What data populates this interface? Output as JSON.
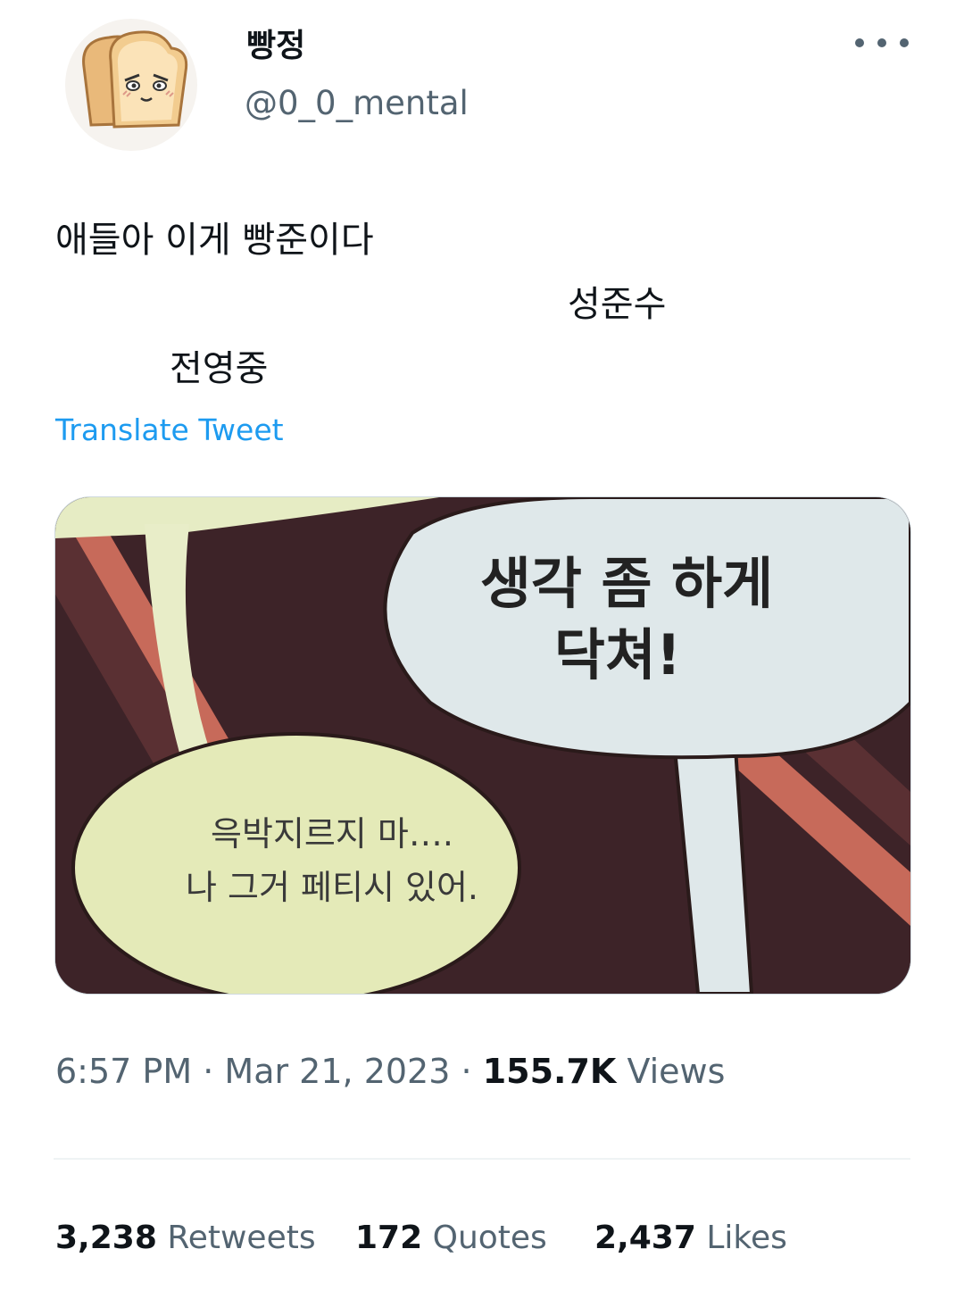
{
  "header": {
    "display_name": "빵정",
    "handle": "@0_0_mental",
    "avatar_icon": "bread-face-icon",
    "more_icon": "more-options-icon"
  },
  "tweet": {
    "lines": [
      "애들아 이게 빵준이다",
      "성준수",
      "전영중"
    ],
    "translate_label": "Translate Tweet"
  },
  "media": {
    "bubble_top": [
      "생각 좀 하게",
      "닥쳐!"
    ],
    "bubble_bottom": [
      "윽박지르지 마….",
      "나 그거 페티시 있어."
    ]
  },
  "meta": {
    "time": "6:57 PM",
    "separator": "·",
    "date": "Mar 21, 2023",
    "views_count": "155.7K",
    "views_label": "Views"
  },
  "stats": {
    "retweets_count": "3,238",
    "retweets_label": "Retweets",
    "quotes_count": "172",
    "quotes_label": "Quotes",
    "likes_count": "2,437",
    "likes_label": "Likes"
  },
  "colors": {
    "link": "#1d9bf0",
    "secondary_text": "#536471",
    "primary_text": "#0f1419"
  }
}
